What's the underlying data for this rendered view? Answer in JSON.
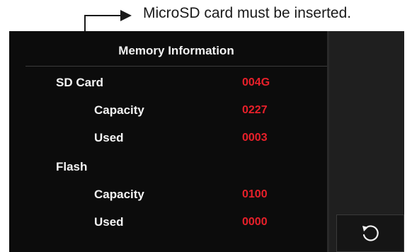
{
  "annotation": {
    "text": "MicroSD card must be inserted."
  },
  "screen": {
    "title": "Memory Information",
    "sd_card": {
      "label": "SD Card",
      "value": "004G",
      "capacity_label": "Capacity",
      "capacity_value": "0227",
      "used_label": "Used",
      "used_value": "0003"
    },
    "flash": {
      "label": "Flash",
      "capacity_label": "Capacity",
      "capacity_value": "0100",
      "used_label": "Used",
      "used_value": "0000"
    },
    "refresh_icon": "refresh-icon"
  },
  "colors": {
    "value_red": "#e8202a",
    "background": "#0b0b0b",
    "label_white": "#f4f4f4"
  }
}
